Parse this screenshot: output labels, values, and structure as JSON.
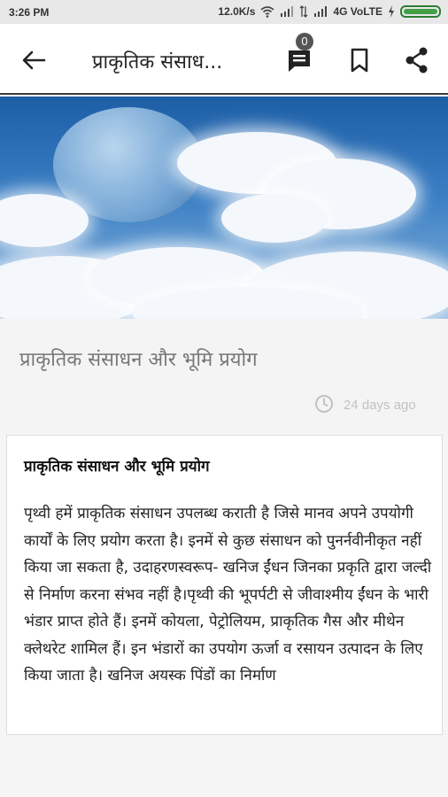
{
  "status_bar": {
    "time": "3:26 PM",
    "network_speed": "12.0K/s",
    "network_type": "4G VoLTE"
  },
  "app_bar": {
    "title": "प्राकृतिक संसाध...",
    "comment_count": "0",
    "icons": [
      "back-arrow-icon",
      "comment-icon",
      "bookmark-icon",
      "share-icon"
    ]
  },
  "article": {
    "title": "प्राकृतिक संसाधन और भूमि प्रयोग",
    "time_ago": "24 days ago",
    "heading": "प्राकृतिक संसाधन और भूमि प्रयोग",
    "body": "पृथ्वी हमें प्राकृतिक संसाधन उपलब्ध कराती है जिसे मानव अपने उपयोगी कार्यों के लिए प्रयोग करता है। इनमें से कुछ संसाधन को पुनर्नवीनीकृत नहीं किया जा सकता है, उदाहरणस्वरूप- खनिज ईंधन जिनका प्रकृति द्वारा जल्दी से निर्माण करना संभव नहीं है।पृथ्वी की भूपर्पटी से जीवाश्मीय ईंधन के भारी भंडार प्राप्त होते हैं। इनमें कोयला, पेट्रोलियम, प्राकृतिक गैस और मीथेन क्लेथरेट शामिल हैं। इन भंडारों का उपयोग ऊर्जा व रसायन उत्पादन के लिए किया जाता है। खनिज अयस्क पिंडों का निर्माण"
  },
  "colors": {
    "app_bar_bg": "#ffffff",
    "title_area_bg": "#f4f4f4",
    "time_ago": "#c2c2c2"
  }
}
